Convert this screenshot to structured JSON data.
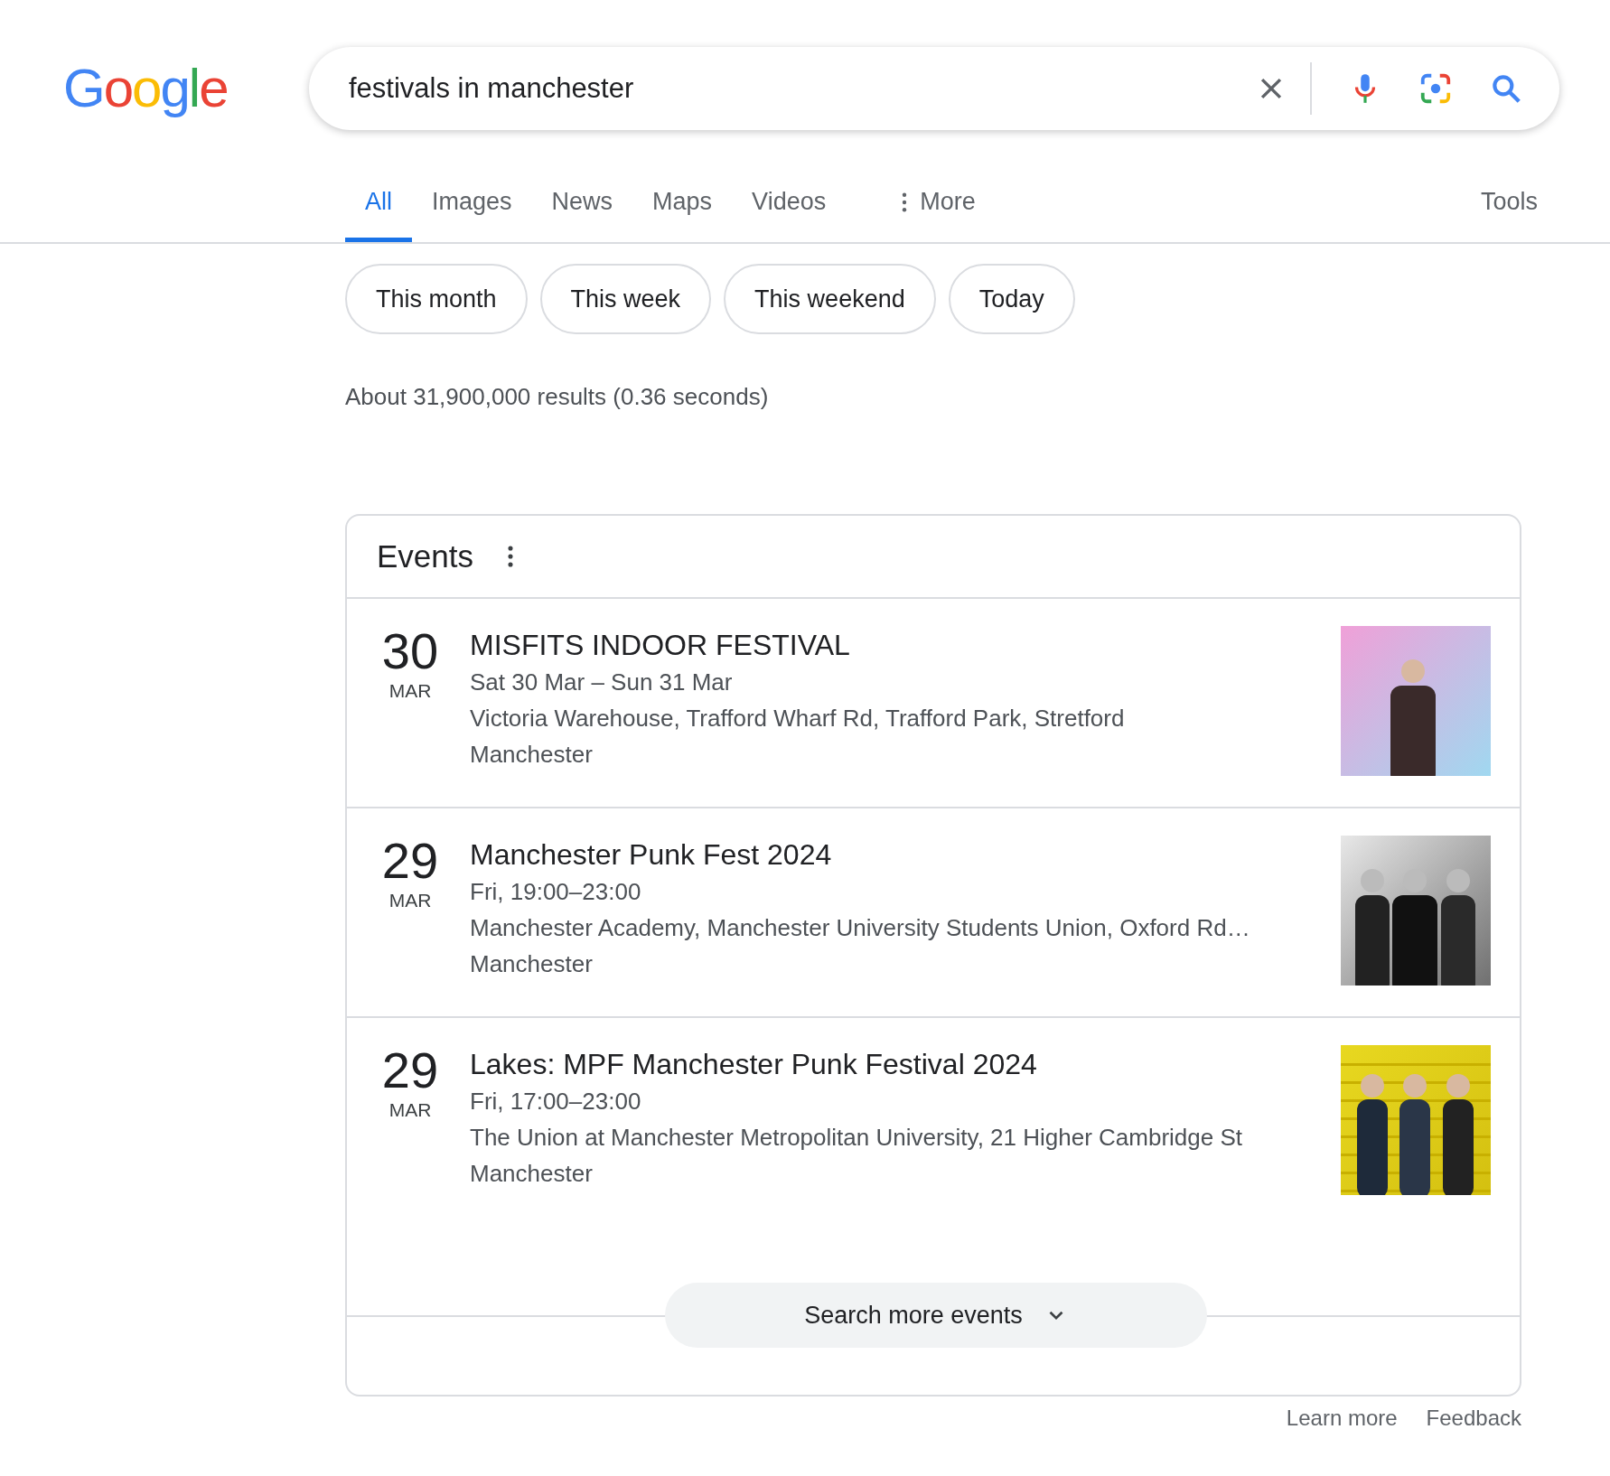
{
  "logo": "Google",
  "search": {
    "value": "festivals in manchester"
  },
  "tabs": [
    {
      "label": "All",
      "selected": true
    },
    {
      "label": "Images",
      "selected": false
    },
    {
      "label": "News",
      "selected": false
    },
    {
      "label": "Maps",
      "selected": false
    },
    {
      "label": "Videos",
      "selected": false
    },
    {
      "label": "More",
      "selected": false,
      "kind": "menu"
    }
  ],
  "tools": "Tools",
  "chips": [
    "This month",
    "This week",
    "This weekend",
    "Today"
  ],
  "result_stats": "About 31,900,000 results (0.36 seconds)",
  "events": {
    "title": "Events",
    "items": [
      {
        "day": "30",
        "month": "MAR",
        "title": "MISFITS INDOOR FESTIVAL",
        "when": "Sat 30 Mar – Sun 31 Mar",
        "venue": "Victoria Warehouse, Trafford Wharf Rd, Trafford Park, Stretford",
        "city": "Manchester"
      },
      {
        "day": "29",
        "month": "MAR",
        "title": "Manchester Punk Fest 2024",
        "when": "Fri, 19:00–23:00",
        "venue": "Manchester Academy, Manchester University Students Union, Oxford Rd…",
        "city": "Manchester"
      },
      {
        "day": "29",
        "month": "MAR",
        "title": "Lakes: MPF Manchester Punk Festival 2024",
        "when": "Fri, 17:00–23:00",
        "venue": "The Union at Manchester Metropolitan University, 21 Higher Cambridge St",
        "city": "Manchester"
      }
    ],
    "more_button": "Search more events"
  },
  "footer_links": [
    "Learn more",
    "Feedback"
  ]
}
